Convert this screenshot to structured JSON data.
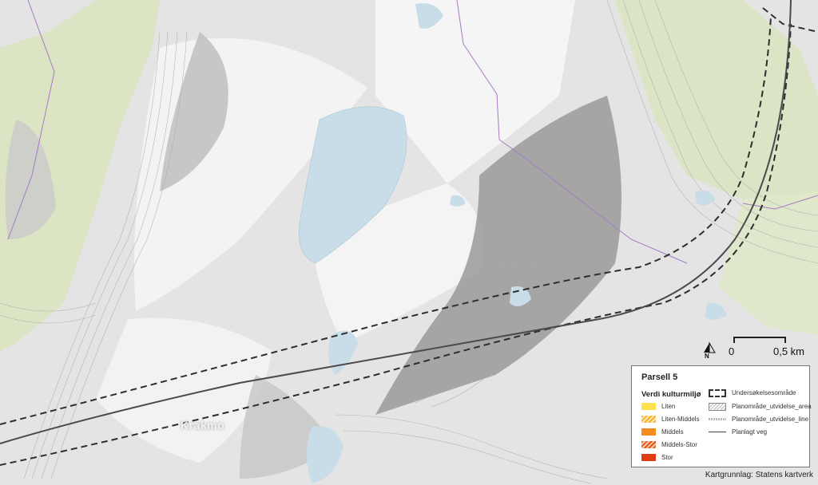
{
  "map": {
    "place_name": "Krakmo",
    "north_label": "N",
    "scale": {
      "start": "0",
      "end": "0,5 km"
    },
    "credit": "Kartgrunnlag: Statens kartverk",
    "colors": {
      "terrain_light": "#f1f1f1",
      "terrain_shadow": "#8d8d8d",
      "vegetation": "#dbe6c1",
      "water": "#c9dde8",
      "contour": "#a5a5a5",
      "boundary": "#a57ac4",
      "road": "#4a4a4a"
    }
  },
  "legend": {
    "title": "Parsell 5",
    "subtitle": "Verdi kulturmiljø",
    "value_items": [
      {
        "label": "Liten",
        "color": "#ffe14d",
        "hatched": false
      },
      {
        "label": "Liten-Middels",
        "color": "#f7b32b",
        "hatched": true
      },
      {
        "label": "Middels",
        "color": "#f28c1e",
        "hatched": false
      },
      {
        "label": "Middels-Stor",
        "color": "#e8531a",
        "hatched": true
      },
      {
        "label": "Stor",
        "color": "#e23a12",
        "hatched": false
      }
    ],
    "line_items": [
      {
        "label": "Undersøkelsesområde",
        "style": "dashed-box"
      },
      {
        "label": "Planområde_utvidelse_area",
        "style": "hatched-box"
      },
      {
        "label": "Planområde_utvidelse_line",
        "style": "dotted-line"
      },
      {
        "label": "Planlagt veg",
        "style": "solid-line"
      }
    ]
  }
}
